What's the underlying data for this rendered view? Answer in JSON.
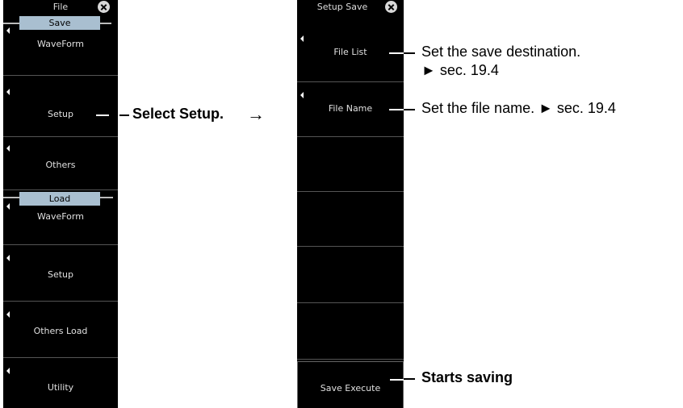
{
  "file_menu": {
    "title": "File",
    "save_group": "Save",
    "save_waveform": "WaveForm",
    "save_setup": "Setup",
    "save_others": "Others",
    "load_group": "Load",
    "load_waveform": "WaveForm",
    "load_setup": "Setup",
    "others_load": "Others Load",
    "utility": "Utility"
  },
  "setup_save_menu": {
    "title": "Setup Save",
    "file_list": "File List",
    "file_name": "File Name",
    "save_execute": "Save Execute"
  },
  "annotations": {
    "select_setup": "Select Setup.",
    "arrow": "→",
    "file_list_desc_line1": "Set the save destination.",
    "file_list_desc_line2": "► sec. 19.4",
    "file_name_desc": "Set the file name. ► sec. 19.4",
    "starts_saving": "Starts saving"
  },
  "colors": {
    "panel": "#000000",
    "group_tag": "#a9bfd0"
  }
}
